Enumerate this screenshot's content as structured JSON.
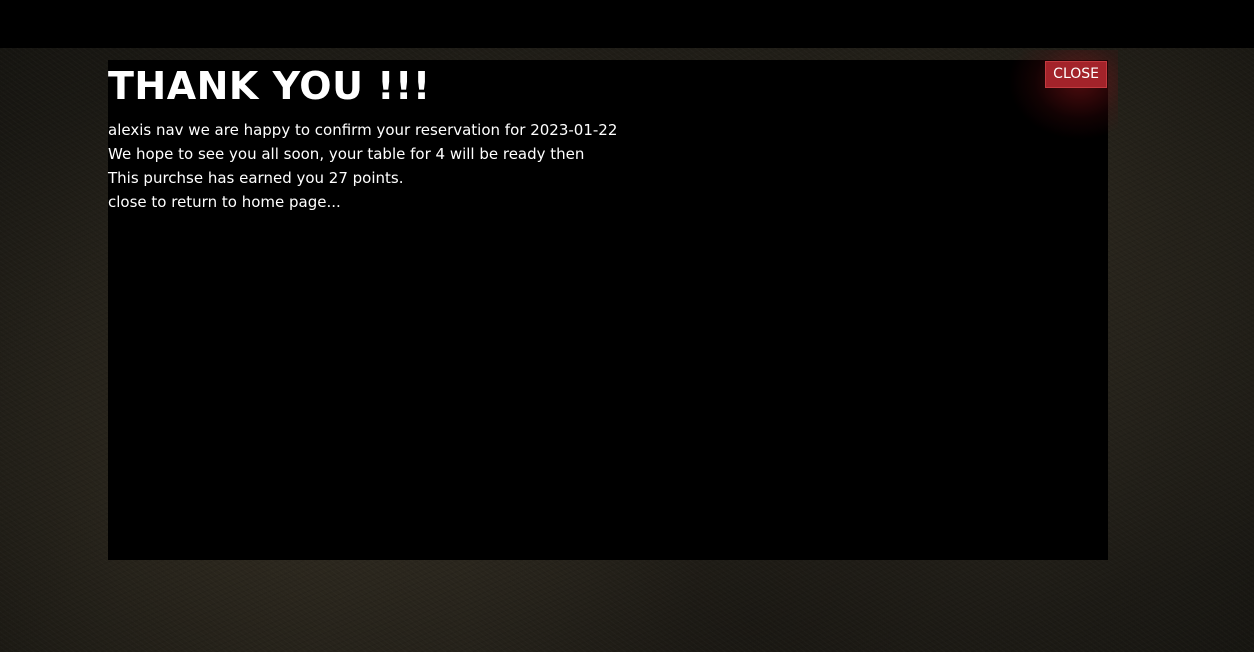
{
  "modal": {
    "title": "THANK YOU !!!",
    "lines": [
      "alexis nav we are happy to confirm your reservation for 2023-01-22",
      "We hope to see you all soon, your table for 4 will be ready then",
      "This purchse has earned you 27 points.",
      "close to return to home page..."
    ],
    "close_label": "CLOSE"
  },
  "colors": {
    "modal_background": "#000000",
    "close_button": "#a3232a",
    "page_background": "#24211a",
    "text": "#ffffff"
  }
}
